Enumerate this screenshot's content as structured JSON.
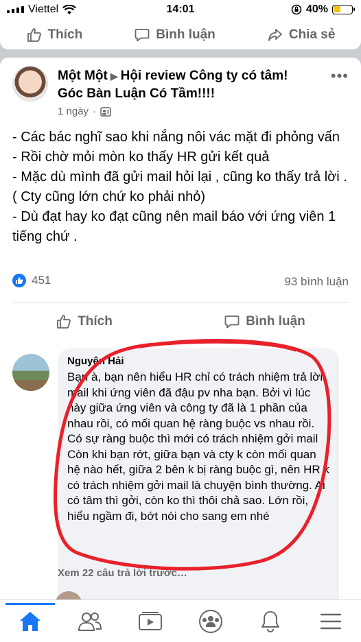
{
  "status_bar": {
    "carrier": "Viettel",
    "time": "14:01",
    "battery": "40%"
  },
  "prev_post_actions": {
    "like": "Thích",
    "comment": "Bình luận",
    "share": "Chia sẻ"
  },
  "post": {
    "author": "Một Một",
    "group": "Hội review Công ty có tâm! Góc Bàn Luận Có Tầm!!!!",
    "time": "1 ngày",
    "body": [
      "- Các bác nghĩ sao khi nắng nôi vác mặt đi phỏng vấn",
      "- Rồi chờ mỏi mòn ko thấy HR gửi kết quả",
      "- Mặc dù mình đã gửi mail hỏi lại , cũng ko thấy trả lời . ( Cty cũng lớn chứ ko phải nhỏ)",
      "- Dù đạt hay ko đạt cũng nên mail báo với ứng viên 1 tiếng chứ ."
    ],
    "reaction_count": "451",
    "comment_count": "93 bình luận",
    "like_label": "Thích",
    "comment_label": "Bình luận"
  },
  "comment": {
    "author": "Nguyên Hải",
    "text": "Bạn à, bạn nên hiểu HR chỉ có trách nhiệm trả lời mail khi ứng viên đã đậu pv nha bạn. Bởi vì lúc này giữa ứng viên và công ty đã là 1 phần của nhau rồi, có mối quan hệ ràng buộc vs nhau rồi. Có sự ràng buộc thì mới có trách nhiệm gởi mail Còn khi bạn rớt, giữa bạn và cty k còn mối quan hệ nào hết, giữa 2 bên k bị ràng buộc gì, nên HR k có trách nhiệm gởi mail là chuyện bình thường. Ai có tâm thì gởi, còn ko thì thôi chả sao. Lớn rồi, hiểu ngầm đi, bớt nói cho sang em nhé",
    "view_more": "Xem 22 câu trả lời trước…"
  },
  "nav": [
    "home-icon",
    "friends-icon",
    "watch-icon",
    "groups-icon",
    "notifications-icon",
    "menu-icon"
  ],
  "colors": {
    "accent": "#1877f2",
    "annotation": "#e8212b",
    "secondary_text": "#65676b"
  }
}
